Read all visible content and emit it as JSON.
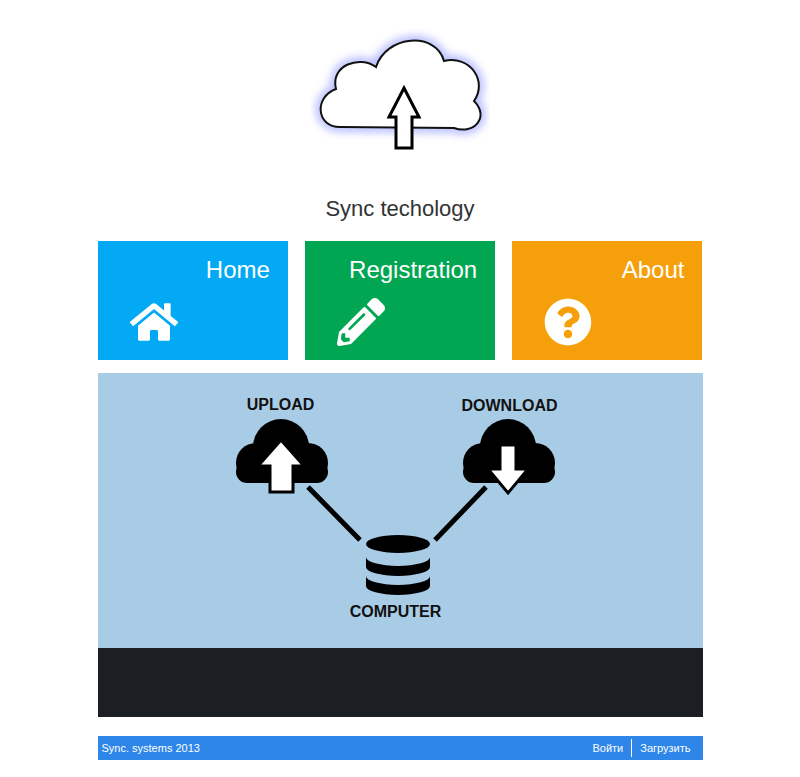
{
  "brand": {
    "title": "Sync techology"
  },
  "tiles": [
    {
      "label": "Home",
      "kind": "home",
      "color": "#03a9f4"
    },
    {
      "label": "Registration",
      "kind": "edit",
      "color": "#00a651"
    },
    {
      "label": "About",
      "kind": "help",
      "color": "#f5a00b"
    }
  ],
  "diagram": {
    "upload": "UPLOAD",
    "download": "DOWNLOAD",
    "computer": "COMPUTER"
  },
  "footer": {
    "copyright": "Sync. systems 2013",
    "links": [
      "Войти",
      "Загрузить"
    ]
  }
}
